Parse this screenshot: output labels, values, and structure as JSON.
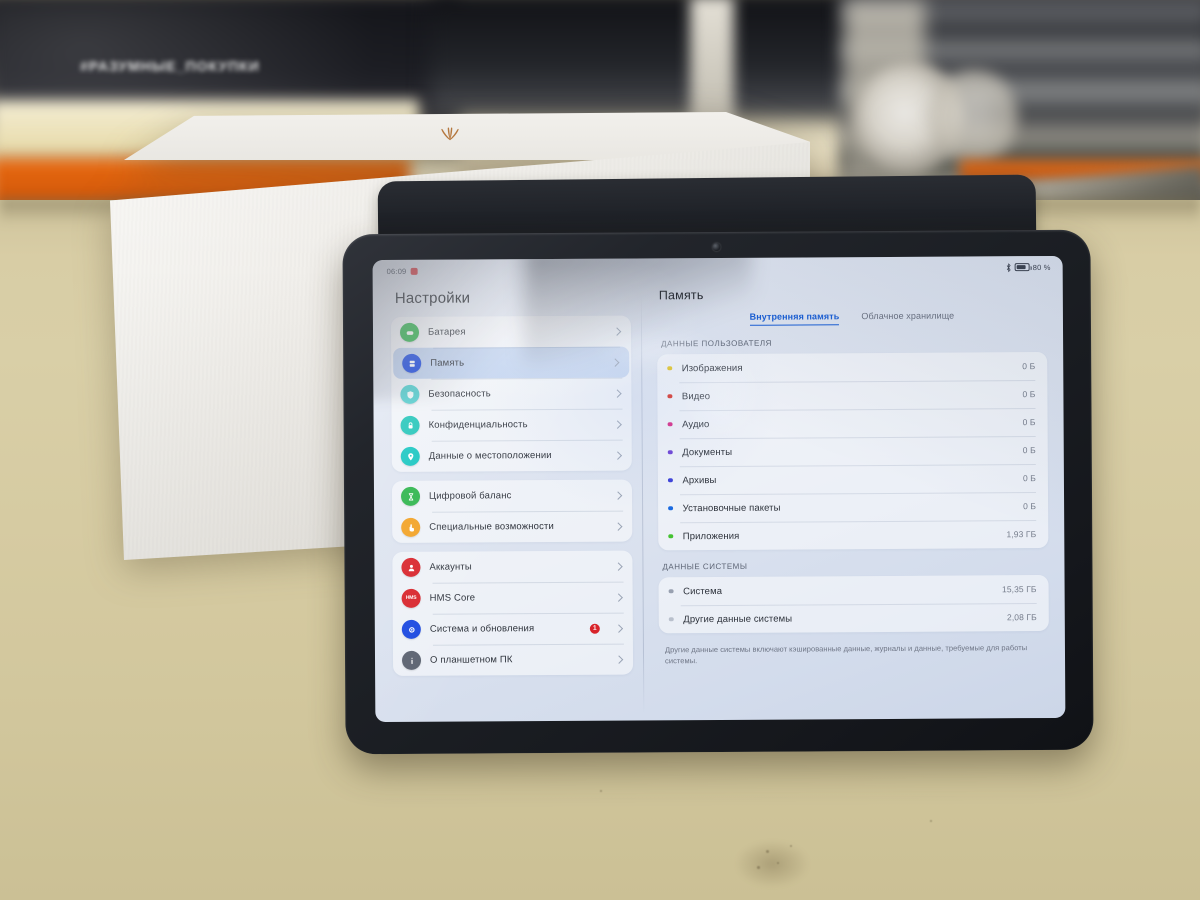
{
  "scene": {
    "background_sign": "#РАЗУМНЫЕ_ПОКУПКИ",
    "table_color": "#d6cba2",
    "box_brand": "HUAWEI"
  },
  "status_bar": {
    "time": "06:09",
    "alarm_icon": "alarm-icon",
    "bluetooth_icon": "bluetooth-icon",
    "battery_icon": "battery-icon",
    "battery_level": "80 %"
  },
  "sidebar": {
    "title": "Настройки",
    "groups": [
      {
        "items": [
          {
            "label": "Батарея",
            "icon": "battery-icon",
            "color": "#2bb44a",
            "selected": false,
            "badge": ""
          },
          {
            "label": "Память",
            "icon": "storage-icon",
            "color": "#1a48e0",
            "selected": true,
            "badge": ""
          },
          {
            "label": "Безопасность",
            "icon": "shield-icon",
            "color": "#54cfd0",
            "selected": false,
            "badge": ""
          },
          {
            "label": "Конфиденциальность",
            "icon": "lock-icon",
            "color": "#1fc4b8",
            "selected": false,
            "badge": ""
          },
          {
            "label": "Данные о местоположении",
            "icon": "location-icon",
            "color": "#14c5c0",
            "selected": false,
            "badge": ""
          }
        ]
      },
      {
        "items": [
          {
            "label": "Цифровой баланс",
            "icon": "hourglass-icon",
            "color": "#2bb44a",
            "selected": false,
            "badge": ""
          },
          {
            "label": "Специальные возможности",
            "icon": "accessibility-icon",
            "color": "#f2a122",
            "selected": false,
            "badge": ""
          }
        ]
      },
      {
        "items": [
          {
            "label": "Аккаунты",
            "icon": "user-icon",
            "color": "#d8232a",
            "selected": false,
            "badge": ""
          },
          {
            "label": "HMS Core",
            "icon": "hms-icon",
            "color": "#d8232a",
            "selected": false,
            "badge": ""
          },
          {
            "label": "Система и обновления",
            "icon": "system-update-icon",
            "color": "#1a48e0",
            "selected": false,
            "badge": "1"
          },
          {
            "label": "О планшетном ПК",
            "icon": "info-icon",
            "color": "#5b6270",
            "selected": false,
            "badge": ""
          }
        ]
      }
    ]
  },
  "main": {
    "title": "Память",
    "tabs": [
      {
        "label": "Внутренняя память",
        "active": true
      },
      {
        "label": "Облачное хранилище",
        "active": false
      }
    ],
    "sections": [
      {
        "heading": "ДАННЫЕ ПОЛЬЗОВАТЕЛЯ",
        "rows": [
          {
            "name": "Изображения",
            "value": "0 Б",
            "color": "#e3c41e"
          },
          {
            "name": "Видео",
            "value": "0 Б",
            "color": "#d8362c"
          },
          {
            "name": "Аудио",
            "value": "0 Б",
            "color": "#d62a87"
          },
          {
            "name": "Документы",
            "value": "0 Б",
            "color": "#6a3fd4"
          },
          {
            "name": "Архивы",
            "value": "0 Б",
            "color": "#3a3fd8"
          },
          {
            "name": "Установочные пакеты",
            "value": "0 Б",
            "color": "#1a6ae0"
          },
          {
            "name": "Приложения",
            "value": "1,93 ГБ",
            "color": "#45c232"
          }
        ]
      },
      {
        "heading": "ДАННЫЕ СИСТЕМЫ",
        "rows": [
          {
            "name": "Система",
            "value": "15,35 ГБ",
            "color": "#98a0b0"
          },
          {
            "name": "Другие данные системы",
            "value": "2,08 ГБ",
            "color": "#b9c0cc"
          }
        ]
      }
    ],
    "note": "Другие данные системы включают кэшированные данные, журналы и данные, требуемые для работы системы."
  }
}
